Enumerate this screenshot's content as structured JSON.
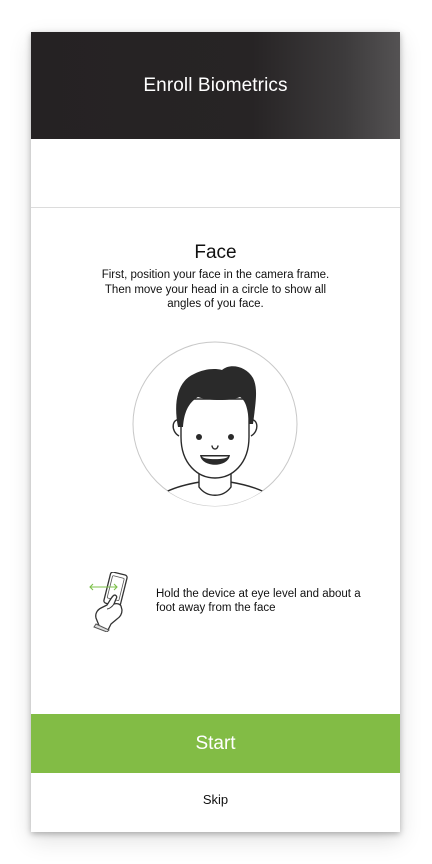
{
  "header": {
    "title": "Enroll Biometrics"
  },
  "section": {
    "title": "Face",
    "description": "First, position your face in the camera frame. Then move your head in a circle to show all angles of you face.",
    "illustration_icon": "face-avatar-icon"
  },
  "tip": {
    "icon": "hand-phone-icon",
    "text": "Hold the device at eye level and about a foot away from the face"
  },
  "actions": {
    "start_label": "Start",
    "skip_label": "Skip"
  },
  "colors": {
    "header_bg": "#252223",
    "accent_green": "#82bc45",
    "tip_arrow_green": "#7cc04a",
    "text": "#111111"
  }
}
